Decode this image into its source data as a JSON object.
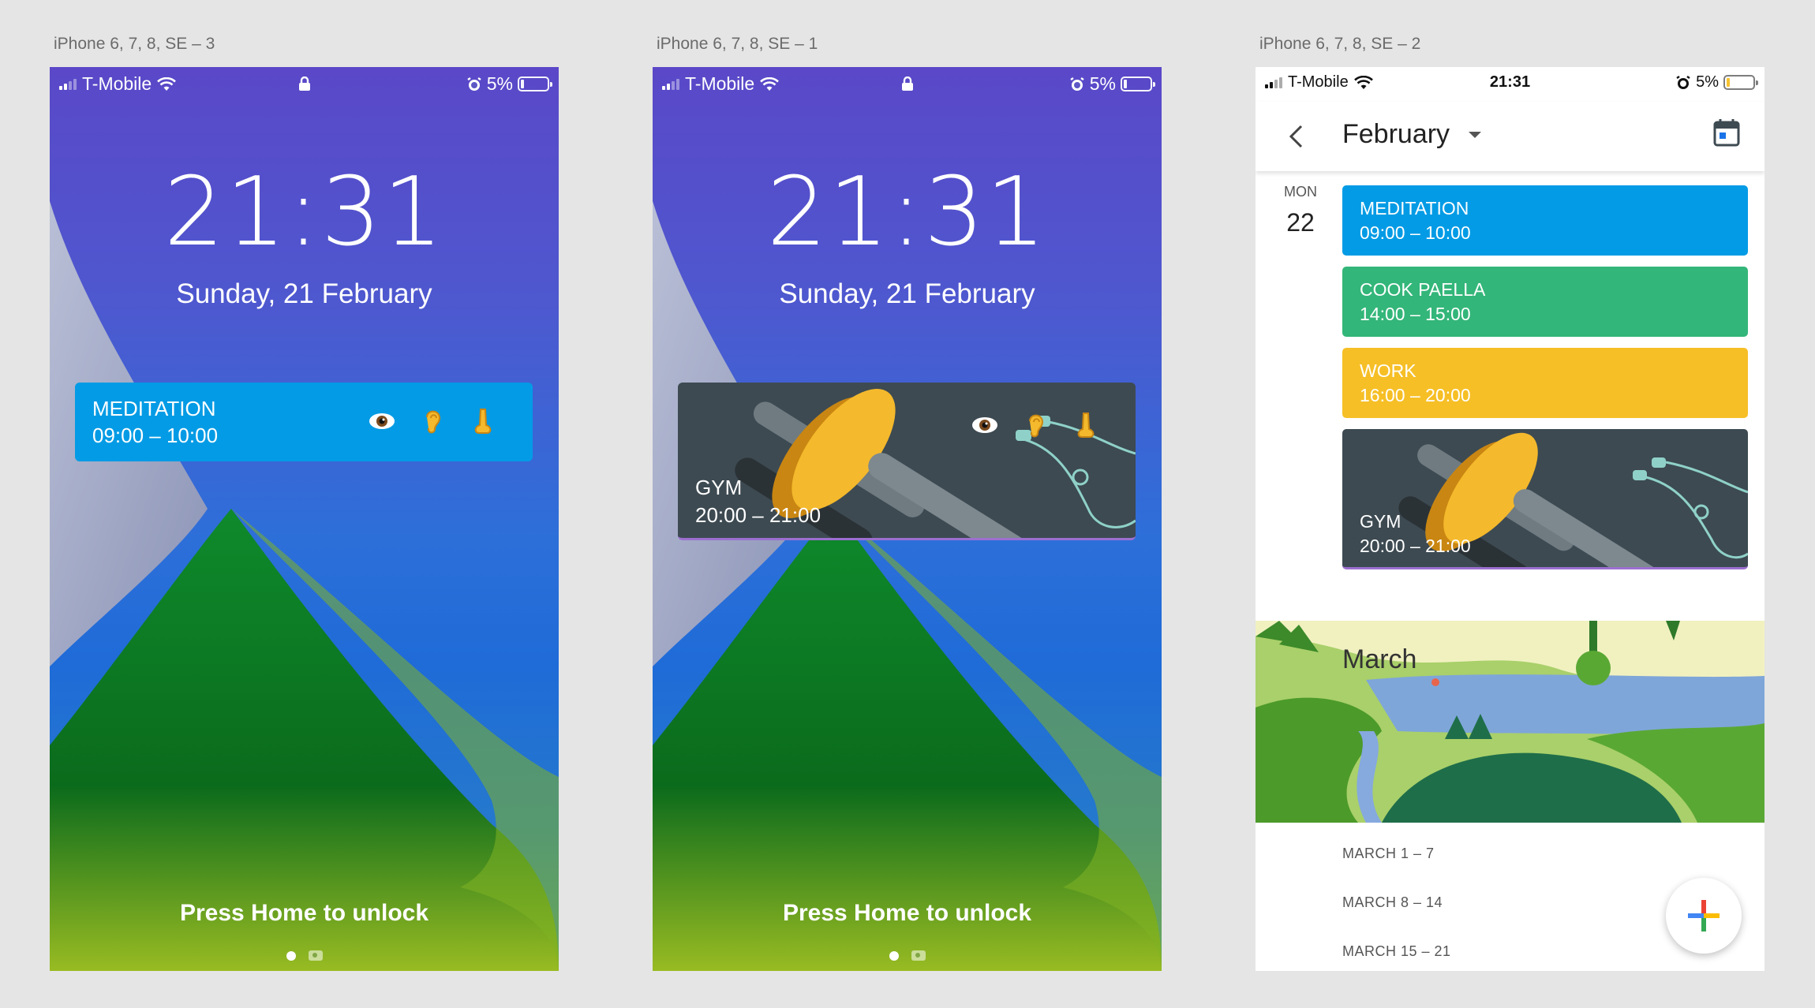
{
  "frames": [
    {
      "label": "iPhone 6, 7, 8, SE – 3"
    },
    {
      "label": "iPhone 6, 7, 8, SE – 1"
    },
    {
      "label": "iPhone 6, 7, 8, SE – 2"
    }
  ],
  "status": {
    "carrier": "T-Mobile",
    "battery": "5%",
    "clock": "21:31"
  },
  "lock": {
    "time": "21:31",
    "date": "Sunday, 21 February",
    "unlock": "Press Home to unlock"
  },
  "widgets": {
    "meditation": {
      "title": "MEDITATION",
      "time": "09:00 – 10:00",
      "icons": [
        "eye-icon",
        "ear-icon",
        "nose-icon"
      ]
    },
    "gym": {
      "title": "GYM",
      "time": "20:00 – 21:00",
      "icons": [
        "eye-icon",
        "ear-icon",
        "nose-icon"
      ]
    }
  },
  "calendar": {
    "month": "February",
    "day": {
      "dow": "MON",
      "num": "22"
    },
    "events": [
      {
        "title": "MEDITATION",
        "time": "09:00 – 10:00",
        "color": "#039be5"
      },
      {
        "title": "COOK PAELLA",
        "time": "14:00 – 15:00",
        "color": "#33b679"
      },
      {
        "title": "WORK",
        "time": "16:00 – 20:00",
        "color": "#f6bf26"
      },
      {
        "title": "GYM",
        "time": "20:00 – 21:00",
        "color": "#3d4a52"
      }
    ],
    "next_month": "March",
    "weeks": [
      "MARCH 1 – 7",
      "MARCH 8 – 14",
      "MARCH 15 – 21"
    ]
  },
  "colors": {
    "meditation": "#039be5",
    "battery_low": "#f6bf26",
    "background": "#e5e5e5"
  }
}
